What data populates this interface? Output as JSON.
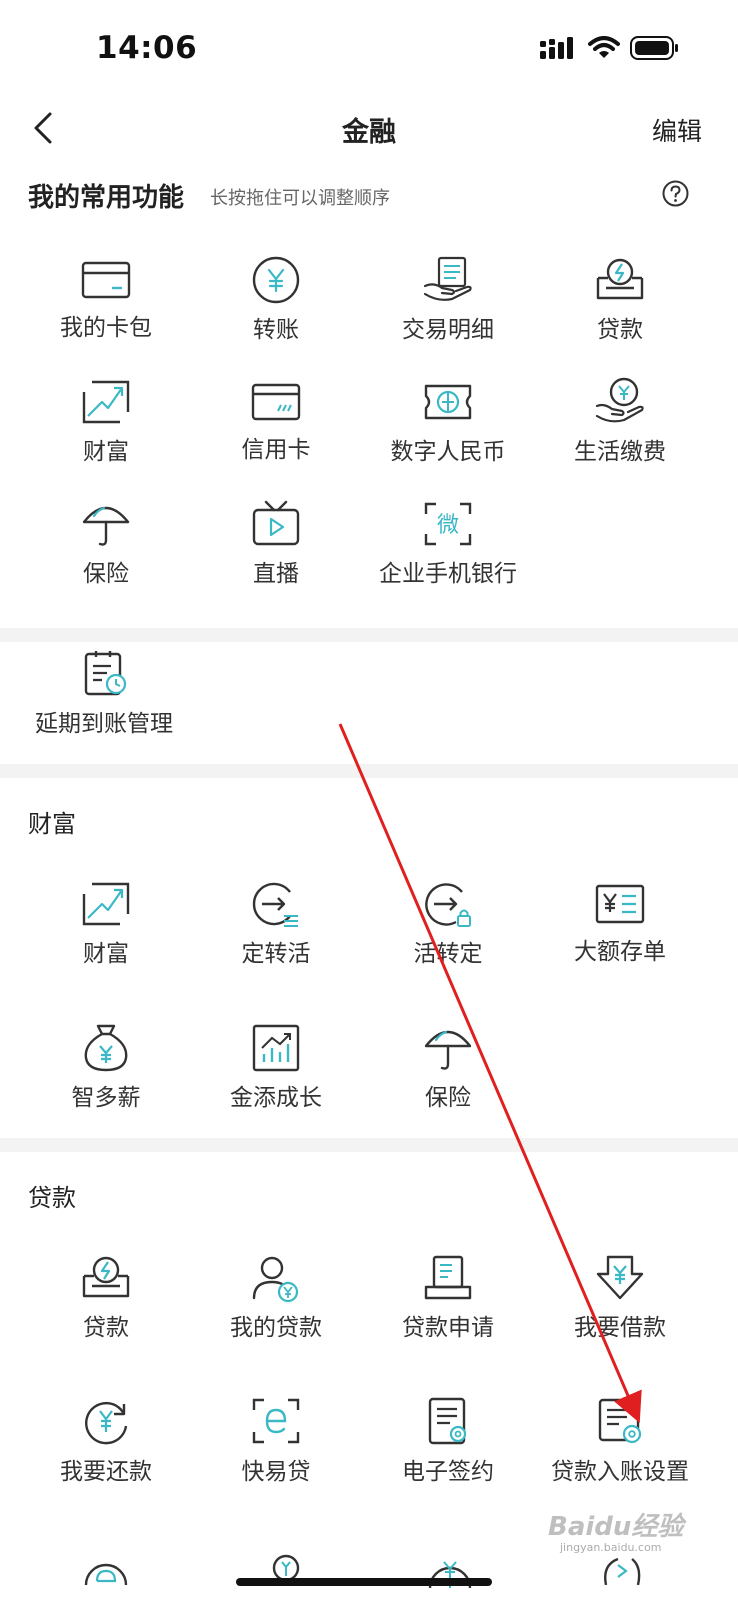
{
  "status_bar": {
    "time": "14:06"
  },
  "nav": {
    "title": "金融",
    "edit": "编辑"
  },
  "common": {
    "title": "我的常用功能",
    "hint": "长按拖住可以调整顺序",
    "items": [
      {
        "label": "我的卡包",
        "icon": "card-wallet-icon"
      },
      {
        "label": "转账",
        "icon": "yuan-circle-icon"
      },
      {
        "label": "交易明细",
        "icon": "hand-receipt-icon"
      },
      {
        "label": "贷款",
        "icon": "loan-box-icon"
      },
      {
        "label": "财富",
        "icon": "trend-chart-icon"
      },
      {
        "label": "信用卡",
        "icon": "credit-card-icon"
      },
      {
        "label": "数字人民币",
        "icon": "digital-rmb-icon"
      },
      {
        "label": "生活缴费",
        "icon": "hand-coin-icon"
      },
      {
        "label": "保险",
        "icon": "umbrella-icon"
      },
      {
        "label": "直播",
        "icon": "tv-play-icon"
      },
      {
        "label": "企业手机银行",
        "icon": "wei-scan-icon"
      }
    ]
  },
  "extra": {
    "items": [
      {
        "label": "延期到账管理",
        "icon": "clipboard-clock-icon"
      }
    ]
  },
  "wealth": {
    "title": "财富",
    "items": [
      {
        "label": "财富",
        "icon": "trend-chart-icon"
      },
      {
        "label": "定转活",
        "icon": "arrow-circle-list-icon"
      },
      {
        "label": "活转定",
        "icon": "arrow-circle-lock-icon"
      },
      {
        "label": "大额存单",
        "icon": "yuan-certificate-icon"
      },
      {
        "label": "智多薪",
        "icon": "money-bag-icon"
      },
      {
        "label": "金添成长",
        "icon": "growth-chart-icon"
      },
      {
        "label": "保险",
        "icon": "umbrella-icon"
      }
    ]
  },
  "loan": {
    "title": "贷款",
    "items": [
      {
        "label": "贷款",
        "icon": "loan-box-icon"
      },
      {
        "label": "我的贷款",
        "icon": "user-yuan-icon"
      },
      {
        "label": "贷款申请",
        "icon": "printer-doc-icon"
      },
      {
        "label": "我要借款",
        "icon": "down-arrow-yuan-icon"
      },
      {
        "label": "我要还款",
        "icon": "yuan-refresh-icon"
      },
      {
        "label": "快易贷",
        "icon": "e-scan-icon"
      },
      {
        "label": "电子签约",
        "icon": "doc-gear-icon"
      },
      {
        "label": "贷款入账设置",
        "icon": "doc-settings-icon"
      }
    ]
  },
  "watermark": {
    "text": "Baidu经验",
    "sub": "jingyan.baidu.com"
  },
  "colors": {
    "accent": "#3bb8c6",
    "stroke": "#333333",
    "annotation": "#e02020"
  }
}
